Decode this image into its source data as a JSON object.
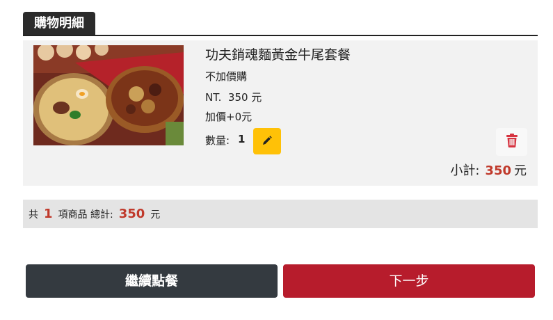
{
  "header": {
    "title": "購物明細"
  },
  "item": {
    "name": "功夫銷魂麵黃金牛尾套餐",
    "addon": "不加價購",
    "price": "NT.  350 元",
    "extra": "加價+0元",
    "qty_label": "數量:",
    "qty": "1",
    "subtotal_label": "小計:",
    "subtotal_amount": "350",
    "subtotal_unit": "元"
  },
  "summary": {
    "prefix": "共",
    "count": "1",
    "mid": "項商品 總計:",
    "total": "350",
    "unit": "元"
  },
  "actions": {
    "continue_label": "繼續點餐",
    "next_label": "下一步"
  },
  "colors": {
    "accent_red": "#c0392b",
    "edit_yellow": "#ffc107",
    "dark_button": "#343a40",
    "primary_red": "#b71c2c"
  },
  "icons": {
    "edit": "pencil-icon",
    "delete": "trash-icon"
  }
}
